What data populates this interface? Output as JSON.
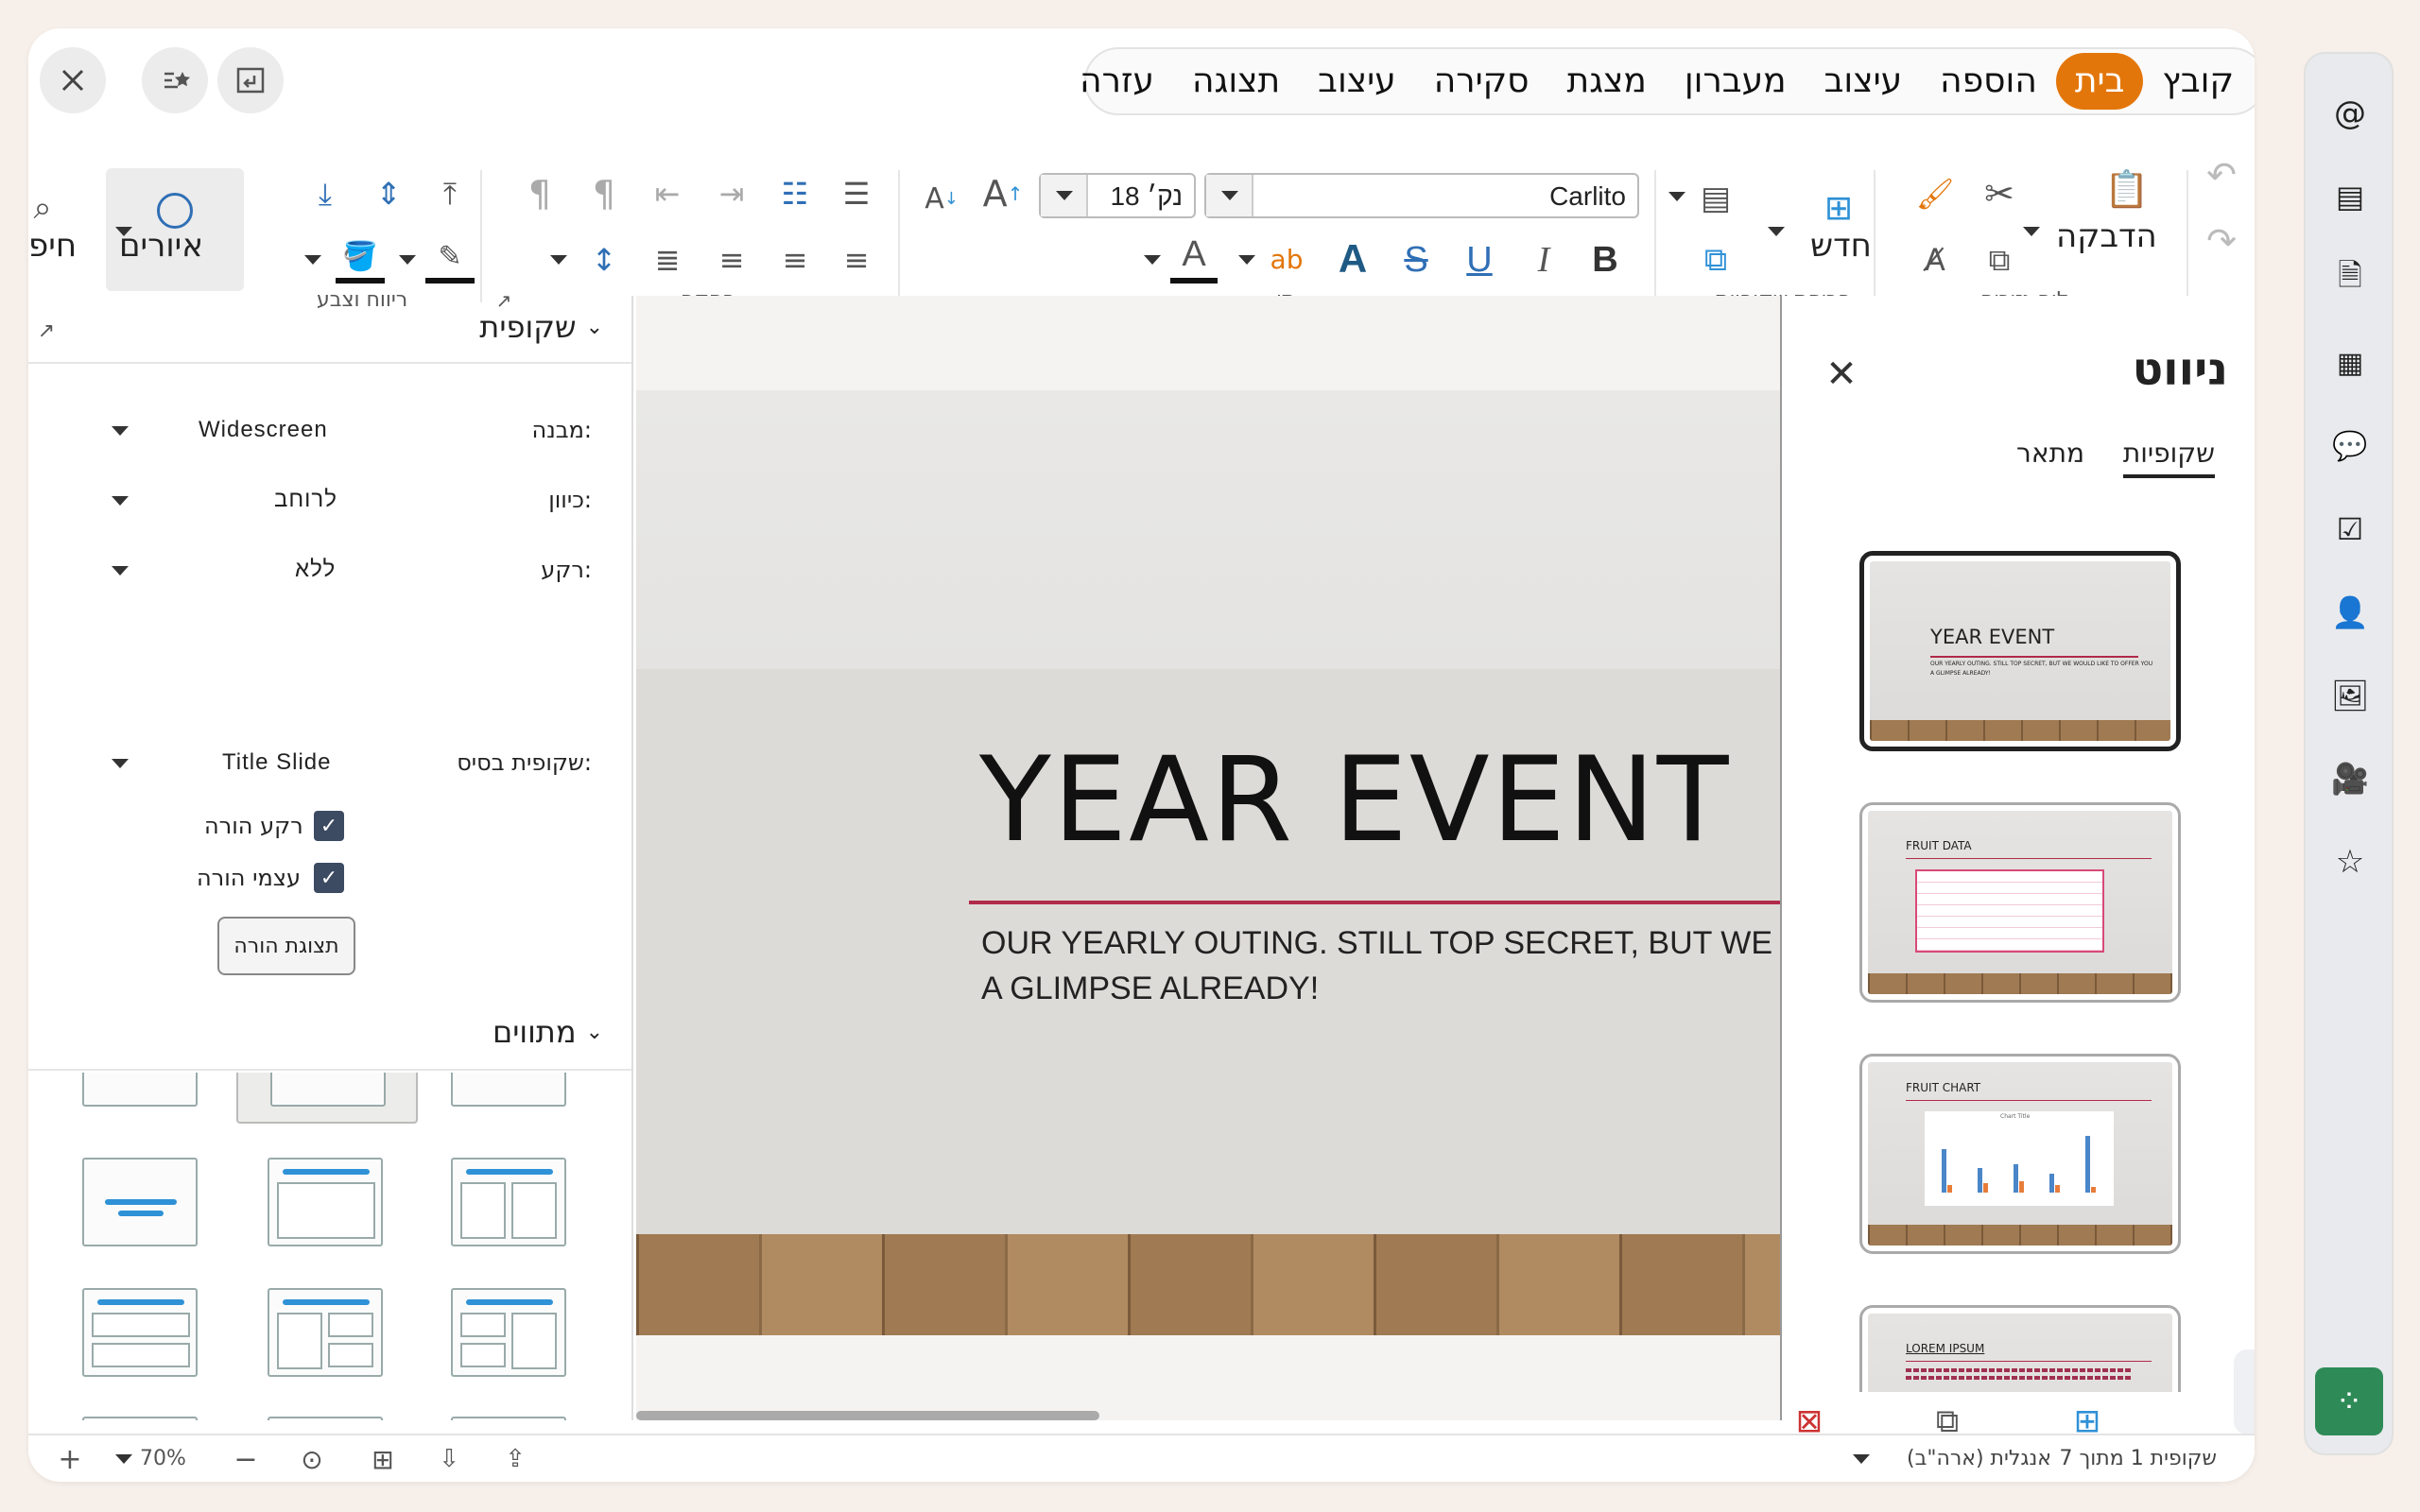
{
  "menu": {
    "items": [
      "קובץ",
      "בית",
      "הוספה",
      "עיצוב",
      "מעברון",
      "מצגת",
      "סקירה",
      "עיצוב",
      "תצוגה",
      "עזרה"
    ],
    "active_index": 1
  },
  "ribbon": {
    "paste_label": "הדבקה",
    "new_label": "חדש",
    "shapes_label": "איורים",
    "find_label_partial": "חיפ",
    "font_name": "Carlito",
    "font_size": "18 נק׳",
    "groups": {
      "clipboard": "לוח גזירים",
      "slides": "פריסת שקופיות",
      "font": "תו",
      "paragraph": "פסקה",
      "spacing": "ריווח וצבע"
    }
  },
  "left_panel": {
    "slide_section_title": "שקופית",
    "format_label": "מבנה:",
    "format_value": "Widescreen",
    "orientation_label": "כיוון:",
    "orientation_value": "לרוחב",
    "background_label": "רקע:",
    "background_value": "ללא",
    "master_label": "שקופית בסיס:",
    "master_value": "Title Slide",
    "master_bg_label": "רקע הורה",
    "master_objects_label": "עצמי הורה",
    "master_view_button": "תצוגת הורה",
    "layouts_section_title": "מתווים"
  },
  "slide": {
    "title": "YEAR EVENT",
    "subtitle_line1": "OUR YEARLY OUTING. STILL TOP SECRET, BUT WE WOU",
    "subtitle_line2": "A GLIMPSE ALREADY!"
  },
  "navigator": {
    "title": "ניווט",
    "tab_slides": "שקופיות",
    "tab_outline": "מתאר",
    "thumbs": [
      {
        "title": "YEAR EVENT",
        "sub1": "OUR YEARLY OUTING. STILL TOP SECRET, BUT WE WOULD LIKE TO OFFER YOU",
        "sub2": "A GLIMPSE ALREADY!"
      },
      {
        "title": "FRUIT DATA"
      },
      {
        "title": "FRUIT CHART",
        "chart_title": "Chart Title"
      },
      {
        "title": "LOREM IPSUM"
      }
    ]
  },
  "status": {
    "slide_info": "שקופית 1 מתוך 7",
    "language": "אנגלית (ארה\"ב)",
    "zoom": "70%"
  },
  "colors": {
    "accent": "#e3760a",
    "check": "#3c4a62",
    "app_green": "#2e8b57"
  }
}
